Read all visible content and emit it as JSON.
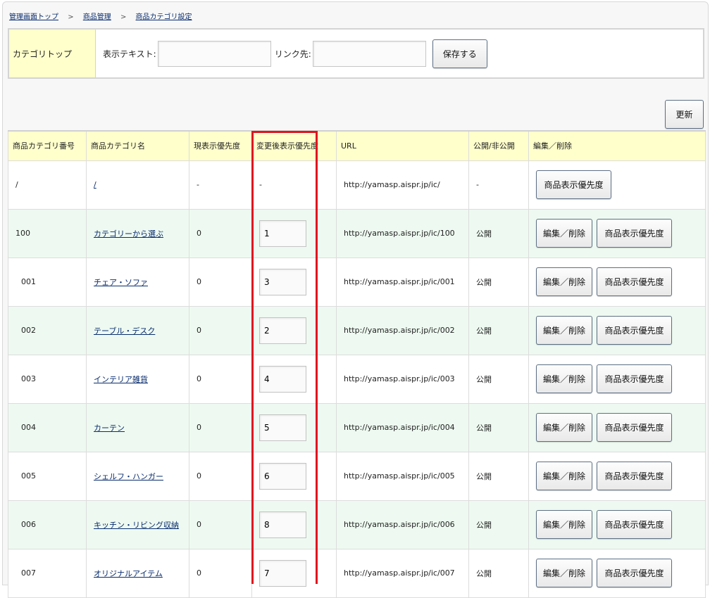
{
  "breadcrumb": {
    "items": [
      "管理画面トップ",
      "商品管理",
      "商品カテゴリ設定"
    ],
    "separator": ">"
  },
  "top_form": {
    "label": "カテゴリトップ",
    "text_label": "表示テキスト:",
    "text_value": "",
    "link_label": "リンク先:",
    "link_value": "",
    "save_label": "保存する"
  },
  "refresh_label": "更新",
  "table": {
    "headers": [
      "商品カテゴリ番号",
      "商品カテゴリ名",
      "現表示優先度",
      "変更後表示優先度",
      "URL",
      "公開/非公開",
      "編集／削除"
    ],
    "edit_label": "編集／削除",
    "priority_label": "商品表示優先度",
    "rows": [
      {
        "num": "/",
        "name": "/",
        "current": "-",
        "new": "-",
        "url": "http://yamasp.aispr.jp/ic/",
        "status": "-"
      },
      {
        "num": "100",
        "name": "カテゴリーから選ぶ",
        "current": "0",
        "new": "1",
        "url": "http://yamasp.aispr.jp/ic/100",
        "status": "公開"
      },
      {
        "num": "001",
        "name": "チェア・ソファ",
        "current": "0",
        "new": "3",
        "url": "http://yamasp.aispr.jp/ic/001",
        "status": "公開"
      },
      {
        "num": "002",
        "name": "テーブル・デスク",
        "current": "0",
        "new": "2",
        "url": "http://yamasp.aispr.jp/ic/002",
        "status": "公開"
      },
      {
        "num": "003",
        "name": "インテリア雑貨",
        "current": "0",
        "new": "4",
        "url": "http://yamasp.aispr.jp/ic/003",
        "status": "公開"
      },
      {
        "num": "004",
        "name": "カーテン",
        "current": "0",
        "new": "5",
        "url": "http://yamasp.aispr.jp/ic/004",
        "status": "公開"
      },
      {
        "num": "005",
        "name": "シェルフ・ハンガー",
        "current": "0",
        "new": "6",
        "url": "http://yamasp.aispr.jp/ic/005",
        "status": "公開"
      },
      {
        "num": "006",
        "name": "キッチン・リビング収納",
        "current": "0",
        "new": "8",
        "url": "http://yamasp.aispr.jp/ic/006",
        "status": "公開"
      },
      {
        "num": "007",
        "name": "オリジナルアイテム",
        "current": "0",
        "new": "7",
        "url": "http://yamasp.aispr.jp/ic/007",
        "status": "公開"
      }
    ]
  },
  "colors": {
    "header_bg": "#ffffcc",
    "alt_row_bg": "#eefaf1",
    "link": "#0a2d6e",
    "highlight": "#e0141e"
  }
}
